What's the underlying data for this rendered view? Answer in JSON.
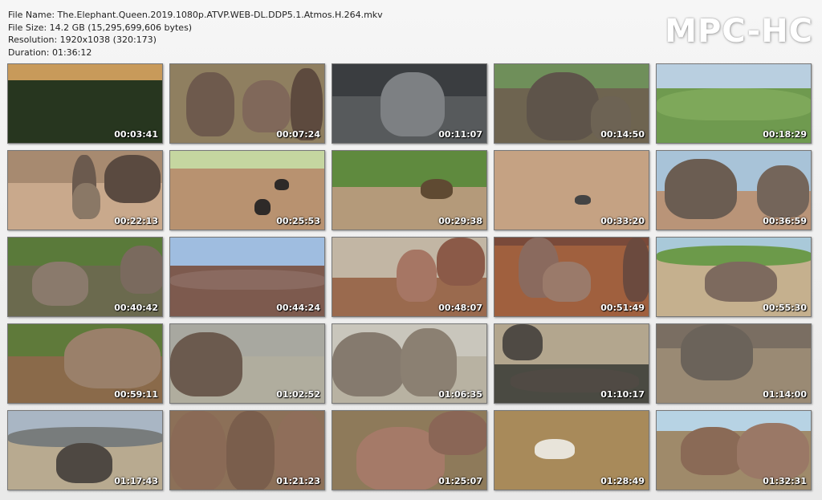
{
  "info": {
    "file_name": "File Name: The.Elephant.Queen.2019.1080p.ATVP.WEB-DL.DDP5.1.Atmos.H.264.mkv",
    "file_size": "File Size: 14.2 GB (15,295,699,606 bytes)",
    "resolution": "Resolution: 1920x1038 (320:173)",
    "duration": "Duration: 01:36:12"
  },
  "brand": "MPC-HC",
  "thumbnails": [
    {
      "time": "00:03:41",
      "sky": "#c89a5a",
      "ground": "#27361f",
      "skyh": 20,
      "blobs": []
    },
    {
      "time": "00:07:24",
      "sky": "#8a7a5a",
      "ground": "#8f7f60",
      "skyh": 0,
      "blobs": [
        [
          "#6e5a4d",
          20,
          10,
          60,
          80
        ],
        [
          "#80685a",
          90,
          20,
          60,
          65
        ],
        [
          "#5d4a3e",
          150,
          5,
          40,
          90
        ]
      ]
    },
    {
      "time": "00:11:07",
      "sky": "#3a3d40",
      "ground": "#575a5c",
      "skyh": 40,
      "blobs": [
        [
          "#7d8083",
          60,
          10,
          80,
          80
        ]
      ]
    },
    {
      "time": "00:14:50",
      "sky": "#6f8f5a",
      "ground": "#6e6450",
      "skyh": 30,
      "blobs": [
        [
          "#5e544a",
          40,
          10,
          90,
          85
        ],
        [
          "#6d6354",
          120,
          40,
          50,
          55
        ]
      ]
    },
    {
      "time": "00:18:29",
      "sky": "#b9cfe0",
      "ground": "#6f9a4f",
      "skyh": 30,
      "blobs": [
        [
          "#7ea85a",
          0,
          30,
          194,
          40
        ]
      ]
    },
    {
      "time": "00:22:13",
      "sky": "#a78a70",
      "ground": "#c9a98c",
      "skyh": 40,
      "blobs": [
        [
          "#6b5a4e",
          80,
          5,
          30,
          80
        ],
        [
          "#5a4a40",
          120,
          5,
          70,
          60
        ],
        [
          "#8a7866",
          80,
          40,
          35,
          45
        ]
      ]
    },
    {
      "time": "00:25:53",
      "sky": "#c5d6a0",
      "ground": "#b89270",
      "skyh": 22,
      "blobs": [
        [
          "#2e2a28",
          130,
          35,
          18,
          14
        ],
        [
          "#2e2a28",
          105,
          60,
          20,
          20
        ]
      ]
    },
    {
      "time": "00:29:38",
      "sky": "#5f8a3e",
      "ground": "#b49a7a",
      "skyh": 45,
      "blobs": [
        [
          "#5f4a32",
          110,
          35,
          40,
          25
        ]
      ]
    },
    {
      "time": "00:33:20",
      "sky": "#c7a584",
      "ground": "#c5a283",
      "skyh": 0,
      "blobs": [
        [
          "#444",
          100,
          55,
          20,
          12
        ]
      ]
    },
    {
      "time": "00:36:59",
      "sky": "#a8c3d8",
      "ground": "#b99478",
      "skyh": 50,
      "blobs": [
        [
          "#6b5d52",
          10,
          10,
          90,
          75
        ],
        [
          "#74655a",
          125,
          18,
          65,
          65
        ]
      ]
    },
    {
      "time": "00:40:42",
      "sky": "#5a7a3a",
      "ground": "#6b6a4e",
      "skyh": 35,
      "blobs": [
        [
          "#8a7a6c",
          30,
          30,
          70,
          55
        ],
        [
          "#7a6a5e",
          140,
          10,
          55,
          60
        ]
      ]
    },
    {
      "time": "00:44:24",
      "sky": "#9fbde0",
      "ground": "#7d5a4e",
      "skyh": 35,
      "blobs": [
        [
          "#8a6a60",
          0,
          40,
          194,
          25
        ]
      ]
    },
    {
      "time": "00:48:07",
      "sky": "#c2b6a4",
      "ground": "#9a6a4e",
      "skyh": 50,
      "blobs": [
        [
          "#a67664",
          80,
          15,
          50,
          65
        ],
        [
          "#8b5a48",
          130,
          0,
          60,
          60
        ]
      ]
    },
    {
      "time": "00:51:49",
      "sky": "#7a4a3a",
      "ground": "#a0603e",
      "skyh": 10,
      "blobs": [
        [
          "#8a6a5e",
          30,
          0,
          50,
          75
        ],
        [
          "#9a7a6a",
          60,
          30,
          60,
          50
        ],
        [
          "#6b4a3e",
          160,
          0,
          34,
          80
        ]
      ]
    },
    {
      "time": "00:55:30",
      "sky": "#a9c9d9",
      "ground": "#c5b08e",
      "skyh": 25,
      "blobs": [
        [
          "#6c9a4a",
          0,
          10,
          194,
          25
        ],
        [
          "#7d6a5e",
          60,
          30,
          90,
          50
        ]
      ]
    },
    {
      "time": "00:59:11",
      "sky": "#5f7a3a",
      "ground": "#8a6a4a",
      "skyh": 40,
      "blobs": [
        [
          "#9a806a",
          70,
          5,
          120,
          75
        ]
      ]
    },
    {
      "time": "01:02:52",
      "sky": "#a8a8a0",
      "ground": "#b0ad9e",
      "skyh": 40,
      "blobs": [
        [
          "#6b5a4e",
          0,
          10,
          90,
          80
        ]
      ]
    },
    {
      "time": "01:06:35",
      "sky": "#c9c6bc",
      "ground": "#b8b2a2",
      "skyh": 40,
      "blobs": [
        [
          "#857a6e",
          0,
          10,
          90,
          80
        ],
        [
          "#8b8072",
          85,
          5,
          70,
          85
        ]
      ]
    },
    {
      "time": "01:10:17",
      "sky": "#b3a68e",
      "ground": "#4a4a42",
      "skyh": 50,
      "blobs": [
        [
          "#4f4a44",
          10,
          0,
          50,
          45
        ],
        [
          "#504a44",
          20,
          55,
          160,
          30
        ]
      ]
    },
    {
      "time": "01:14:00",
      "sky": "#7a6e62",
      "ground": "#9a8a74",
      "skyh": 30,
      "blobs": [
        [
          "#6b635a",
          30,
          0,
          90,
          70
        ]
      ]
    },
    {
      "time": "01:17:43",
      "sky": "#a9b6c4",
      "ground": "#b8aa90",
      "skyh": 30,
      "blobs": [
        [
          "#787c7c",
          0,
          20,
          194,
          25
        ],
        [
          "#4e4842",
          60,
          40,
          70,
          50
        ]
      ]
    },
    {
      "time": "01:21:23",
      "sky": "#8a6e58",
      "ground": "#8c7058",
      "skyh": 0,
      "blobs": [
        [
          "#8a6a56",
          0,
          0,
          70,
          100
        ],
        [
          "#7a5e4c",
          70,
          0,
          60,
          100
        ],
        [
          "#8f6e5a",
          130,
          0,
          64,
          100
        ]
      ]
    },
    {
      "time": "01:25:07",
      "sky": "#9f8a4a",
      "ground": "#8e7a5a",
      "skyh": 0,
      "blobs": [
        [
          "#a57a68",
          30,
          20,
          110,
          80
        ],
        [
          "#8a6656",
          120,
          0,
          74,
          55
        ]
      ]
    },
    {
      "time": "01:28:49",
      "sky": "#b89a68",
      "ground": "#a88a5a",
      "skyh": 0,
      "blobs": [
        [
          "#e8e4da",
          50,
          35,
          50,
          25
        ]
      ]
    },
    {
      "time": "01:32:31",
      "sky": "#b7d3e4",
      "ground": "#9f8a6a",
      "skyh": 25,
      "blobs": [
        [
          "#8a6a56",
          30,
          20,
          80,
          60
        ],
        [
          "#9a7866",
          100,
          15,
          90,
          70
        ]
      ]
    }
  ]
}
